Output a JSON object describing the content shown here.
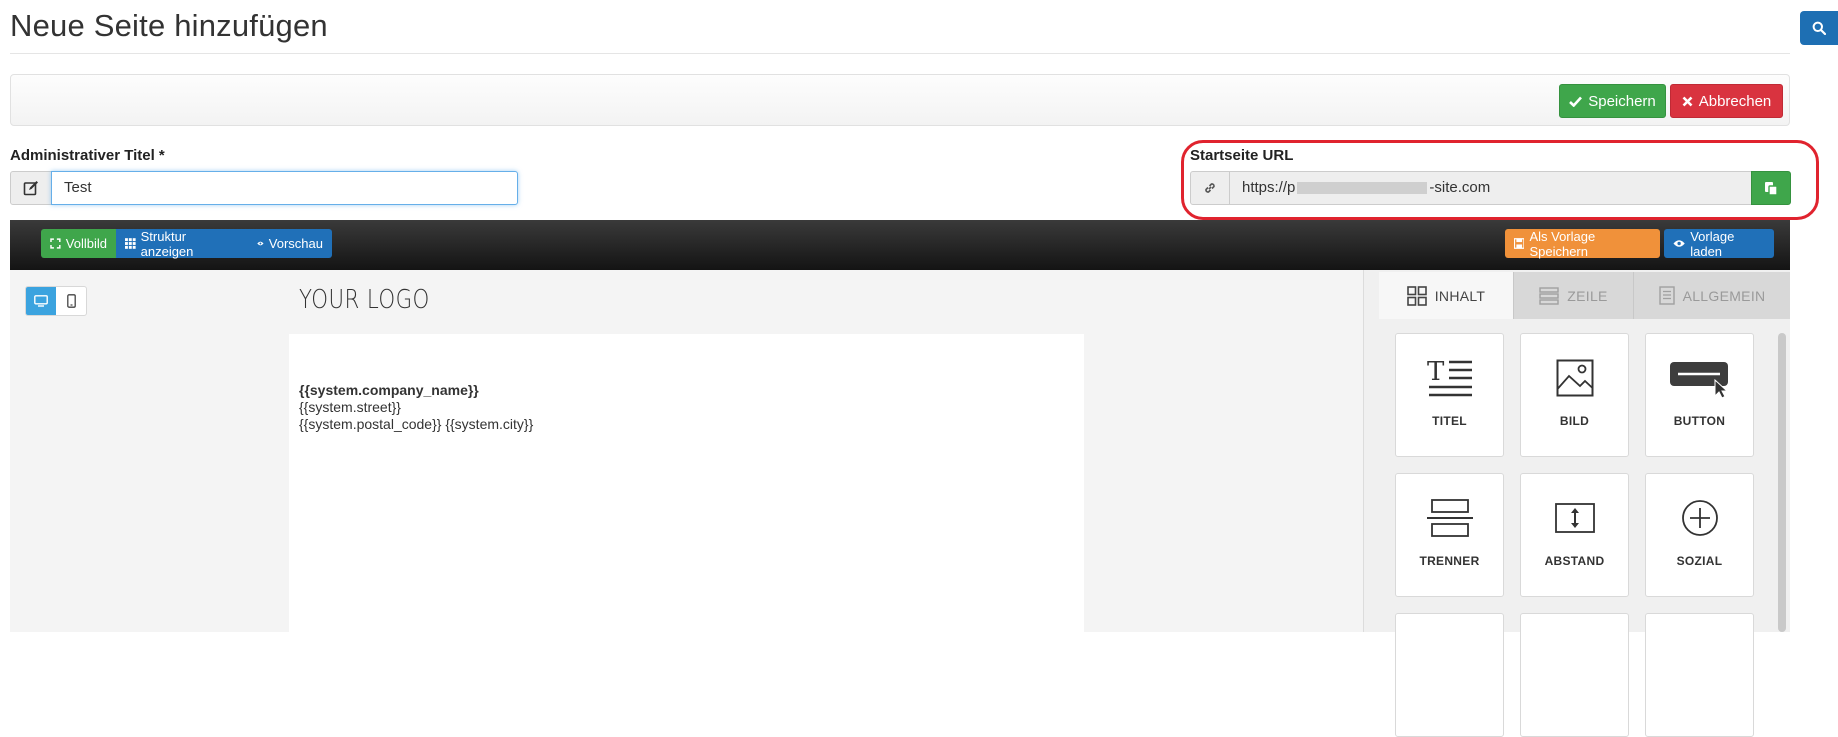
{
  "page": {
    "title": "Neue Seite hinzufügen"
  },
  "actions": {
    "save_label": "Speichern",
    "cancel_label": "Abbrechen"
  },
  "form": {
    "admin_title_label": "Administrativer Titel *",
    "admin_title_value": "Test",
    "url_label": "Startseite URL",
    "url_prefix": "https://p",
    "url_suffix": "-site.com"
  },
  "editor": {
    "fullscreen_label": "Vollbild",
    "structure_label": "Struktur anzeigen",
    "preview_label": "Vorschau",
    "save_template_label": "Als Vorlage Speichern",
    "load_template_label": "Vorlage laden"
  },
  "canvas": {
    "logo": "YOUR LOGO",
    "company": "{{system.company_name}}",
    "street": "{{system.street}}",
    "postal_city": "{{system.postal_code}} {{system.city}}"
  },
  "sidebar": {
    "tabs": [
      {
        "label": "INHALT",
        "icon": "grid-icon",
        "active": true
      },
      {
        "label": "ZEILE",
        "icon": "rows-icon",
        "active": false
      },
      {
        "label": "ALLGEMEIN",
        "icon": "document-icon",
        "active": false
      }
    ],
    "tiles": [
      {
        "label": "TITEL",
        "icon": "title-icon"
      },
      {
        "label": "BILD",
        "icon": "image-icon"
      },
      {
        "label": "BUTTON",
        "icon": "button-icon"
      },
      {
        "label": "TRENNER",
        "icon": "divider-icon"
      },
      {
        "label": "ABSTAND",
        "icon": "spacer-icon"
      },
      {
        "label": "SOZIAL",
        "icon": "social-plus-icon"
      }
    ]
  },
  "colors": {
    "success": "#3fa64b",
    "danger": "#d9333f",
    "primary": "#2070b8",
    "warning": "#f0913a",
    "highlight": "#e0232e"
  }
}
